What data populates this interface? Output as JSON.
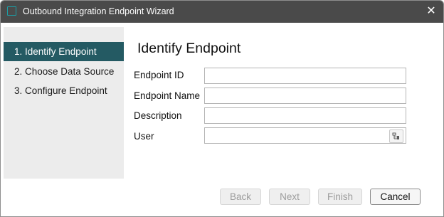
{
  "window": {
    "title": "Outbound Integration Endpoint Wizard",
    "close_glyph": "✕",
    "icon": "window-app-icon"
  },
  "sidebar": {
    "items": [
      {
        "label": "1. Identify Endpoint",
        "active": true
      },
      {
        "label": "2. Choose Data Source",
        "active": false
      },
      {
        "label": "3. Configure Endpoint",
        "active": false
      }
    ]
  },
  "main": {
    "title": "Identify Endpoint",
    "fields": [
      {
        "label": "Endpoint ID",
        "value": "",
        "placeholder": ""
      },
      {
        "label": "Endpoint Name",
        "value": "",
        "placeholder": ""
      },
      {
        "label": "Description",
        "value": "",
        "placeholder": ""
      },
      {
        "label": "User",
        "value": "",
        "placeholder": "",
        "has_picker": true,
        "picker_icon": "user-picker-icon"
      }
    ]
  },
  "buttons": {
    "back": {
      "label": "Back",
      "enabled": false
    },
    "next": {
      "label": "Next",
      "enabled": false
    },
    "finish": {
      "label": "Finish",
      "enabled": false
    },
    "cancel": {
      "label": "Cancel",
      "enabled": true
    }
  },
  "colors": {
    "titlebar": "#4a4a4a",
    "accent": "#245a63",
    "icon_accent": "#1aa0a8",
    "sidebar_bg": "#ececec"
  }
}
